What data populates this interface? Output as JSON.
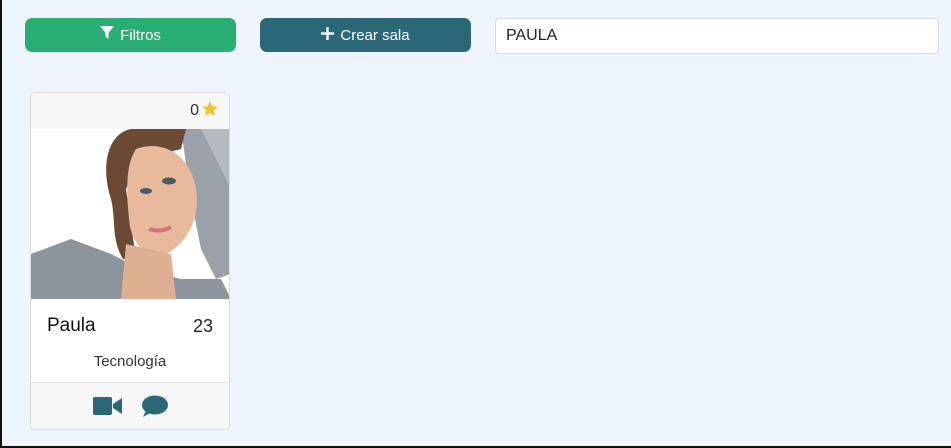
{
  "toolbar": {
    "filters_label": "Filtros",
    "create_room_label": "Crear sala",
    "create_room_icon": "plus-icon",
    "filters_icon": "filter-icon"
  },
  "search": {
    "value": "PAULA",
    "placeholder": ""
  },
  "profile_card": {
    "rating": "0",
    "rating_icon": "star-icon",
    "name": "Paula",
    "age": "23",
    "category": "Tecnología",
    "actions": [
      {
        "icon": "video-camera-icon"
      },
      {
        "icon": "chat-bubble-icon"
      }
    ]
  },
  "colors": {
    "filters_button": "#28ad72",
    "create_button": "#2a6878",
    "star": "#f3c431",
    "action_icons": "#2a6878",
    "background": "#eef5fd"
  }
}
